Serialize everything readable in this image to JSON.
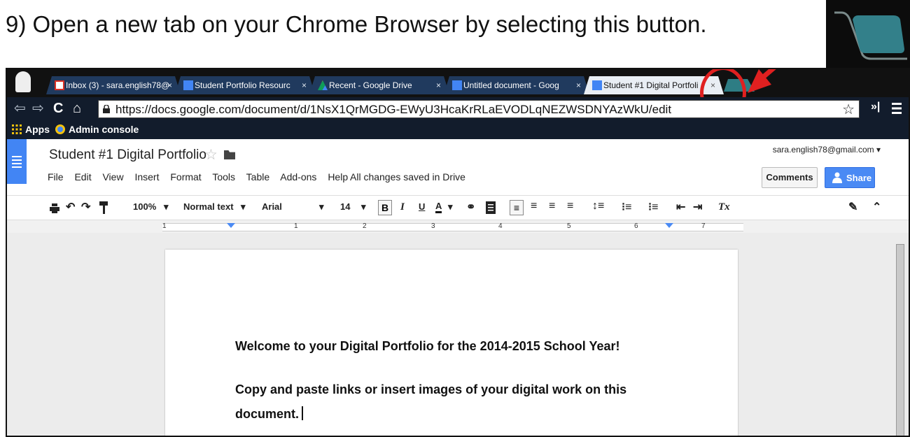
{
  "instruction": {
    "text": "9) Open a new tab on your Chrome Browser by selecting this button."
  },
  "tabs": [
    {
      "label": "Inbox (3) - sara.english78@",
      "icon": "gmail-icon",
      "active": false
    },
    {
      "label": "Student Portfolio Resourc",
      "icon": "docs-icon",
      "active": false
    },
    {
      "label": "Recent - Google Drive",
      "icon": "drive-icon",
      "active": false
    },
    {
      "label": "Untitled document - Goog",
      "icon": "docs-icon",
      "active": false
    },
    {
      "label": "Student #1 Digital Portfoli",
      "icon": "docs-icon",
      "active": true
    }
  ],
  "tab_close_glyph": "×",
  "toolbar": {
    "back": "⇦",
    "forward": "⇨",
    "reload": "C",
    "home": "⌂",
    "url": "https://docs.google.com/document/d/1NsX1QrMGDG-EWyU3HcaKrRLaEVODLqNEZWSDNYAzWkU/edit",
    "star": "☆",
    "extensions": "»|"
  },
  "bookmarks": [
    {
      "label": "Apps",
      "icon": "apps-grid-icon"
    },
    {
      "label": "Admin console",
      "icon": "admin-console-icon"
    }
  ],
  "docs": {
    "title": "Student #1 Digital Portfolio",
    "star": "☆",
    "menus": [
      "File",
      "Edit",
      "View",
      "Insert",
      "Format",
      "Tools",
      "Table",
      "Add-ons",
      "Help"
    ],
    "save_status": "All changes saved in Drive",
    "account": "sara.english78@gmail.com ▾",
    "comments_label": "Comments",
    "share_label": "Share"
  },
  "format_toolbar": {
    "zoom": "100%",
    "style": "Normal text",
    "font": "Arial",
    "size": "14",
    "bold": "B",
    "italic": "I",
    "underline": "U",
    "text_color": "A",
    "dropdown_glyph": "▾",
    "clear_format": "Tx"
  },
  "ruler_numbers": [
    "1",
    "1",
    "2",
    "3",
    "4",
    "5",
    "6",
    "7"
  ],
  "document": {
    "line1": "Welcome to your Digital Portfolio for the 2014-2015 School Year!",
    "line2": "Copy and paste links or insert images of your digital work on this",
    "line3": "document."
  },
  "colors": {
    "annotation_red": "#e02020",
    "new_tab_teal": "#2e7d84",
    "share_blue": "#4a8af4",
    "docs_blue": "#4285f4"
  }
}
